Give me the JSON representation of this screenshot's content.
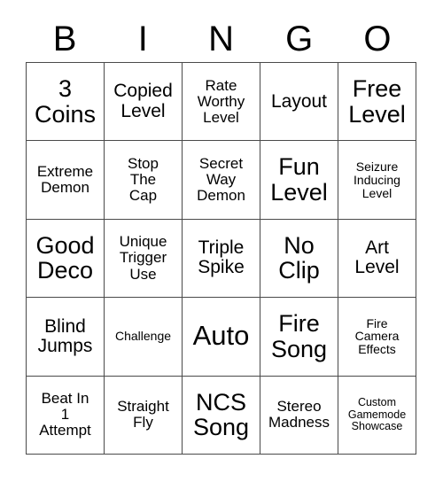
{
  "header": {
    "letters": [
      "B",
      "I",
      "N",
      "G",
      "O"
    ]
  },
  "grid": {
    "columns": 5,
    "rows": 5,
    "cells": [
      {
        "text": "3\nCoins",
        "size": "fs-lg"
      },
      {
        "text": "Copied\nLevel",
        "size": "fs-md"
      },
      {
        "text": "Rate\nWorthy\nLevel",
        "size": "fs-sm"
      },
      {
        "text": "Layout",
        "size": "fs-md"
      },
      {
        "text": "Free\nLevel",
        "size": "fs-lg"
      },
      {
        "text": "Extreme\nDemon",
        "size": "fs-sm"
      },
      {
        "text": "Stop\nThe\nCap",
        "size": "fs-sm"
      },
      {
        "text": "Secret\nWay\nDemon",
        "size": "fs-sm"
      },
      {
        "text": "Fun\nLevel",
        "size": "fs-lg"
      },
      {
        "text": "Seizure\nInducing\nLevel",
        "size": "fs-xs"
      },
      {
        "text": "Good\nDeco",
        "size": "fs-lg"
      },
      {
        "text": "Unique\nTrigger\nUse",
        "size": "fs-sm"
      },
      {
        "text": "Triple\nSpike",
        "size": "fs-md"
      },
      {
        "text": "No\nClip",
        "size": "fs-lg"
      },
      {
        "text": "Art\nLevel",
        "size": "fs-md"
      },
      {
        "text": "Blind\nJumps",
        "size": "fs-md"
      },
      {
        "text": "Challenge",
        "size": "fs-xs"
      },
      {
        "text": "Auto",
        "size": "fs-xl"
      },
      {
        "text": "Fire\nSong",
        "size": "fs-lg"
      },
      {
        "text": "Fire\nCamera\nEffects",
        "size": "fs-xs"
      },
      {
        "text": "Beat In\n1\nAttempt",
        "size": "fs-sm"
      },
      {
        "text": "Straight\nFly",
        "size": "fs-sm"
      },
      {
        "text": "NCS\nSong",
        "size": "fs-lg"
      },
      {
        "text": "Stereo\nMadness",
        "size": "fs-sm"
      },
      {
        "text": "Custom\nGamemode\nShowcase",
        "size": "fs-xxs"
      }
    ]
  },
  "colors": {
    "background": "#ffffff",
    "text": "#000000",
    "border": "#4a4a4a"
  }
}
